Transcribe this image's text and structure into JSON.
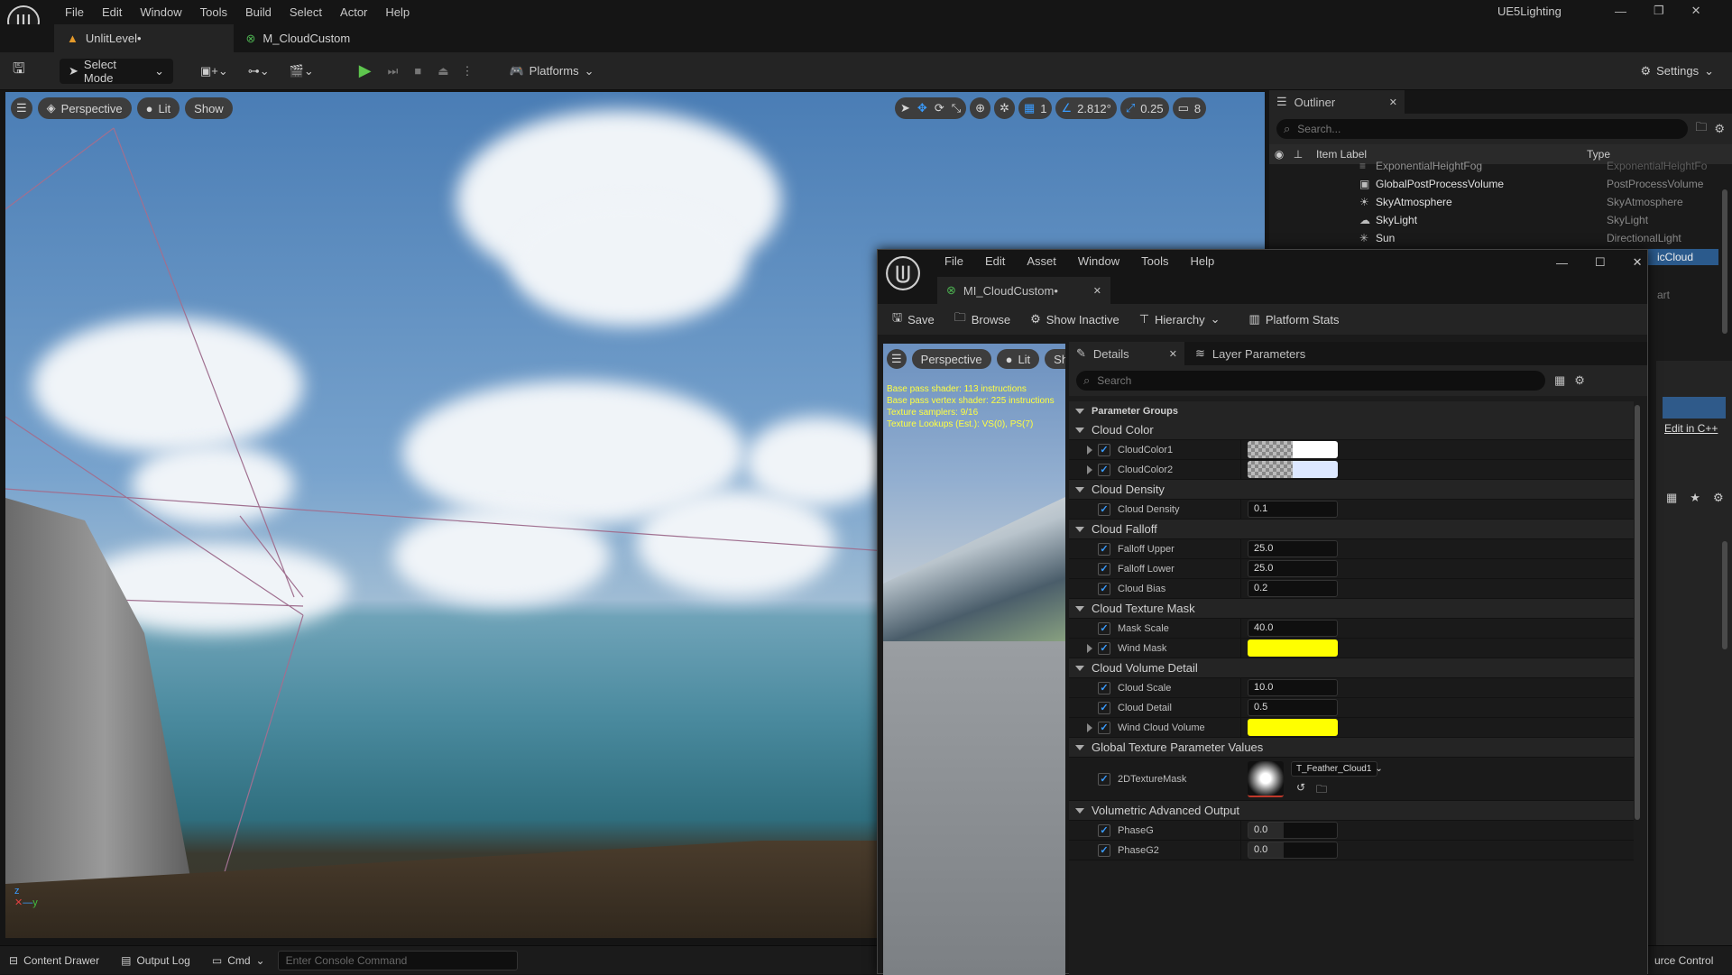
{
  "app": {
    "project_name": "UE5Lighting"
  },
  "menu": [
    "File",
    "Edit",
    "Window",
    "Tools",
    "Build",
    "Select",
    "Actor",
    "Help"
  ],
  "tabs": [
    {
      "label": "UnlitLevel•"
    },
    {
      "label": "M_CloudCustom"
    }
  ],
  "toolbar": {
    "select_mode": "Select Mode",
    "platforms": "Platforms",
    "settings": "Settings"
  },
  "viewport": {
    "perspective": "Perspective",
    "lit": "Lit",
    "show": "Show",
    "angle_snap": "2.812°",
    "scale_snap": "0.25",
    "grid_size": "1",
    "camera_speed": "8"
  },
  "outliner": {
    "title": "Outliner",
    "search_placeholder": "Search...",
    "col_label": "Item Label",
    "col_type": "Type",
    "rows": [
      {
        "label": "ExponentialHeightFog",
        "type": "ExponentialHeightFo"
      },
      {
        "label": "GlobalPostProcessVolume",
        "type": "PostProcessVolume"
      },
      {
        "label": "SkyAtmosphere",
        "type": "SkyAtmosphere"
      },
      {
        "label": "SkyLight",
        "type": "SkyLight"
      },
      {
        "label": "Sun",
        "type": "DirectionalLight"
      }
    ],
    "selected_type_partial": "icCloud",
    "partial_text": "art",
    "edit_cpp": "Edit in C++"
  },
  "status": {
    "content_drawer": "Content Drawer",
    "output_log": "Output Log",
    "cmd": "Cmd",
    "console_placeholder": "Enter Console Command",
    "source_control_partial": "urce Control"
  },
  "material_editor": {
    "menu": [
      "File",
      "Edit",
      "Asset",
      "Window",
      "Tools",
      "Help"
    ],
    "tab": "MI_CloudCustom•",
    "toolbar": {
      "save": "Save",
      "browse": "Browse",
      "show_inactive": "Show Inactive",
      "hierarchy": "Hierarchy",
      "platform_stats": "Platform Stats"
    },
    "preview": {
      "perspective": "Perspective",
      "lit": "Lit",
      "show": "Show",
      "stats": [
        "Base pass shader: 113 instructions",
        "Base pass vertex shader: 225 instructions",
        "Texture samplers: 9/16",
        "Texture Lookups (Est.): VS(0), PS(7)"
      ]
    },
    "details_tab": "Details",
    "layer_tab": "Layer Parameters",
    "search_placeholder": "Search",
    "param_groups": "Parameter Groups",
    "groups": [
      {
        "name": "Cloud Color"
      },
      {
        "name": "Cloud Density"
      },
      {
        "name": "Cloud Falloff"
      },
      {
        "name": "Cloud Texture Mask"
      },
      {
        "name": "Cloud Volume Detail"
      },
      {
        "name": "Global Texture Parameter Values"
      },
      {
        "name": "Volumetric Advanced Output"
      }
    ],
    "params": {
      "cloudcolor1": "CloudColor1",
      "cloudcolor2": "CloudColor2",
      "cloud_density": "Cloud Density",
      "cloud_density_val": "0.1",
      "falloff_upper": "Falloff Upper",
      "falloff_upper_val": "25.0",
      "falloff_lower": "Falloff Lower",
      "falloff_lower_val": "25.0",
      "cloud_bias": "Cloud Bias",
      "cloud_bias_val": "0.2",
      "mask_scale": "Mask Scale",
      "mask_scale_val": "40.0",
      "wind_mask": "Wind Mask",
      "cloud_scale": "Cloud Scale",
      "cloud_scale_val": "10.0",
      "cloud_detail": "Cloud Detail",
      "cloud_detail_val": "0.5",
      "wind_cloud_volume": "Wind Cloud Volume",
      "texture_mask": "2DTextureMask",
      "texture_name": "T_Feather_Cloud1",
      "phaseg": "PhaseG",
      "phaseg_val": "0.0",
      "phaseg2": "PhaseG2",
      "phaseg2_val": "0.0"
    },
    "colors": {
      "yellow": "#ffff00",
      "white": "#ffffff",
      "light_blue": "#dde8ff"
    }
  }
}
